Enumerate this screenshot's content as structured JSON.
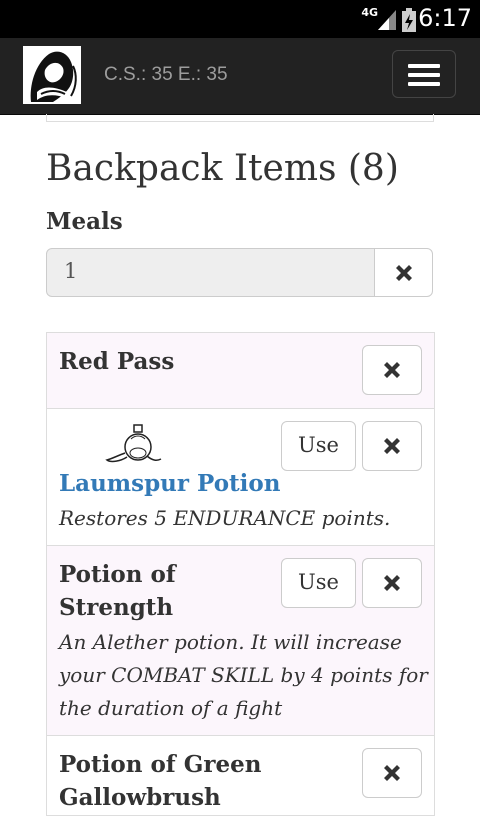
{
  "status_bar": {
    "network": "4G",
    "time": "6:17"
  },
  "nav": {
    "stats": "C.S.: 35 E.: 35"
  },
  "backpack": {
    "heading": "Backpack Items (8)",
    "meals_label": "Meals",
    "meals_value": "1"
  },
  "items": [
    {
      "name": "Red Pass"
    },
    {
      "name": "Laumspur Potion",
      "description": "Restores 5 ENDURANCE points.",
      "use_label": "Use",
      "icon": "potion-flask-icon"
    },
    {
      "name_line1": "Potion of",
      "name_line2": "Strength",
      "desc_line1": "An Alether potion. It will increase",
      "desc_line2": "your COMBAT SKILL by 4 points for",
      "desc_line3": "the duration of a fight",
      "use_label": "Use"
    },
    {
      "name_line1": "Potion of Green",
      "name_line2": "Gallowbrush"
    }
  ]
}
